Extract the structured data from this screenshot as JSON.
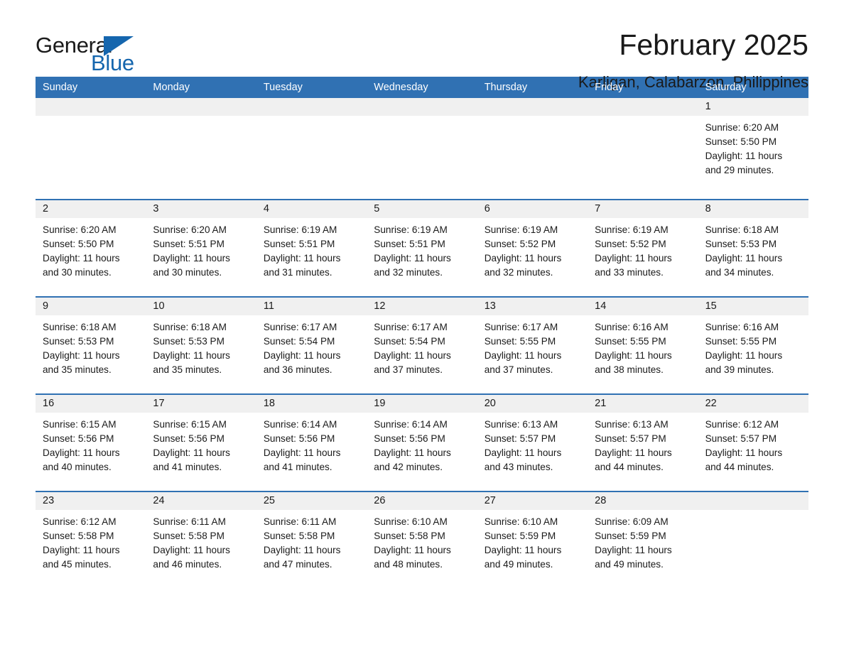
{
  "brand": {
    "name_part1": "General",
    "name_part2": "Blue",
    "accent_color": "#1566ae"
  },
  "header": {
    "title": "February 2025",
    "subtitle": "Karligan, Calabarzon, Philippines"
  },
  "calendar": {
    "header_color": "#3071b3",
    "daynum_band_color": "#f0f0f0",
    "weekdays": [
      "Sunday",
      "Monday",
      "Tuesday",
      "Wednesday",
      "Thursday",
      "Friday",
      "Saturday"
    ],
    "weeks": [
      [
        {
          "day": "",
          "lines": []
        },
        {
          "day": "",
          "lines": []
        },
        {
          "day": "",
          "lines": []
        },
        {
          "day": "",
          "lines": []
        },
        {
          "day": "",
          "lines": []
        },
        {
          "day": "",
          "lines": []
        },
        {
          "day": "1",
          "lines": [
            "Sunrise: 6:20 AM",
            "Sunset: 5:50 PM",
            "Daylight: 11 hours",
            "and 29 minutes."
          ]
        }
      ],
      [
        {
          "day": "2",
          "lines": [
            "Sunrise: 6:20 AM",
            "Sunset: 5:50 PM",
            "Daylight: 11 hours",
            "and 30 minutes."
          ]
        },
        {
          "day": "3",
          "lines": [
            "Sunrise: 6:20 AM",
            "Sunset: 5:51 PM",
            "Daylight: 11 hours",
            "and 30 minutes."
          ]
        },
        {
          "day": "4",
          "lines": [
            "Sunrise: 6:19 AM",
            "Sunset: 5:51 PM",
            "Daylight: 11 hours",
            "and 31 minutes."
          ]
        },
        {
          "day": "5",
          "lines": [
            "Sunrise: 6:19 AM",
            "Sunset: 5:51 PM",
            "Daylight: 11 hours",
            "and 32 minutes."
          ]
        },
        {
          "day": "6",
          "lines": [
            "Sunrise: 6:19 AM",
            "Sunset: 5:52 PM",
            "Daylight: 11 hours",
            "and 32 minutes."
          ]
        },
        {
          "day": "7",
          "lines": [
            "Sunrise: 6:19 AM",
            "Sunset: 5:52 PM",
            "Daylight: 11 hours",
            "and 33 minutes."
          ]
        },
        {
          "day": "8",
          "lines": [
            "Sunrise: 6:18 AM",
            "Sunset: 5:53 PM",
            "Daylight: 11 hours",
            "and 34 minutes."
          ]
        }
      ],
      [
        {
          "day": "9",
          "lines": [
            "Sunrise: 6:18 AM",
            "Sunset: 5:53 PM",
            "Daylight: 11 hours",
            "and 35 minutes."
          ]
        },
        {
          "day": "10",
          "lines": [
            "Sunrise: 6:18 AM",
            "Sunset: 5:53 PM",
            "Daylight: 11 hours",
            "and 35 minutes."
          ]
        },
        {
          "day": "11",
          "lines": [
            "Sunrise: 6:17 AM",
            "Sunset: 5:54 PM",
            "Daylight: 11 hours",
            "and 36 minutes."
          ]
        },
        {
          "day": "12",
          "lines": [
            "Sunrise: 6:17 AM",
            "Sunset: 5:54 PM",
            "Daylight: 11 hours",
            "and 37 minutes."
          ]
        },
        {
          "day": "13",
          "lines": [
            "Sunrise: 6:17 AM",
            "Sunset: 5:55 PM",
            "Daylight: 11 hours",
            "and 37 minutes."
          ]
        },
        {
          "day": "14",
          "lines": [
            "Sunrise: 6:16 AM",
            "Sunset: 5:55 PM",
            "Daylight: 11 hours",
            "and 38 minutes."
          ]
        },
        {
          "day": "15",
          "lines": [
            "Sunrise: 6:16 AM",
            "Sunset: 5:55 PM",
            "Daylight: 11 hours",
            "and 39 minutes."
          ]
        }
      ],
      [
        {
          "day": "16",
          "lines": [
            "Sunrise: 6:15 AM",
            "Sunset: 5:56 PM",
            "Daylight: 11 hours",
            "and 40 minutes."
          ]
        },
        {
          "day": "17",
          "lines": [
            "Sunrise: 6:15 AM",
            "Sunset: 5:56 PM",
            "Daylight: 11 hours",
            "and 41 minutes."
          ]
        },
        {
          "day": "18",
          "lines": [
            "Sunrise: 6:14 AM",
            "Sunset: 5:56 PM",
            "Daylight: 11 hours",
            "and 41 minutes."
          ]
        },
        {
          "day": "19",
          "lines": [
            "Sunrise: 6:14 AM",
            "Sunset: 5:56 PM",
            "Daylight: 11 hours",
            "and 42 minutes."
          ]
        },
        {
          "day": "20",
          "lines": [
            "Sunrise: 6:13 AM",
            "Sunset: 5:57 PM",
            "Daylight: 11 hours",
            "and 43 minutes."
          ]
        },
        {
          "day": "21",
          "lines": [
            "Sunrise: 6:13 AM",
            "Sunset: 5:57 PM",
            "Daylight: 11 hours",
            "and 44 minutes."
          ]
        },
        {
          "day": "22",
          "lines": [
            "Sunrise: 6:12 AM",
            "Sunset: 5:57 PM",
            "Daylight: 11 hours",
            "and 44 minutes."
          ]
        }
      ],
      [
        {
          "day": "23",
          "lines": [
            "Sunrise: 6:12 AM",
            "Sunset: 5:58 PM",
            "Daylight: 11 hours",
            "and 45 minutes."
          ]
        },
        {
          "day": "24",
          "lines": [
            "Sunrise: 6:11 AM",
            "Sunset: 5:58 PM",
            "Daylight: 11 hours",
            "and 46 minutes."
          ]
        },
        {
          "day": "25",
          "lines": [
            "Sunrise: 6:11 AM",
            "Sunset: 5:58 PM",
            "Daylight: 11 hours",
            "and 47 minutes."
          ]
        },
        {
          "day": "26",
          "lines": [
            "Sunrise: 6:10 AM",
            "Sunset: 5:58 PM",
            "Daylight: 11 hours",
            "and 48 minutes."
          ]
        },
        {
          "day": "27",
          "lines": [
            "Sunrise: 6:10 AM",
            "Sunset: 5:59 PM",
            "Daylight: 11 hours",
            "and 49 minutes."
          ]
        },
        {
          "day": "28",
          "lines": [
            "Sunrise: 6:09 AM",
            "Sunset: 5:59 PM",
            "Daylight: 11 hours",
            "and 49 minutes."
          ]
        },
        {
          "day": "",
          "lines": []
        }
      ]
    ]
  }
}
